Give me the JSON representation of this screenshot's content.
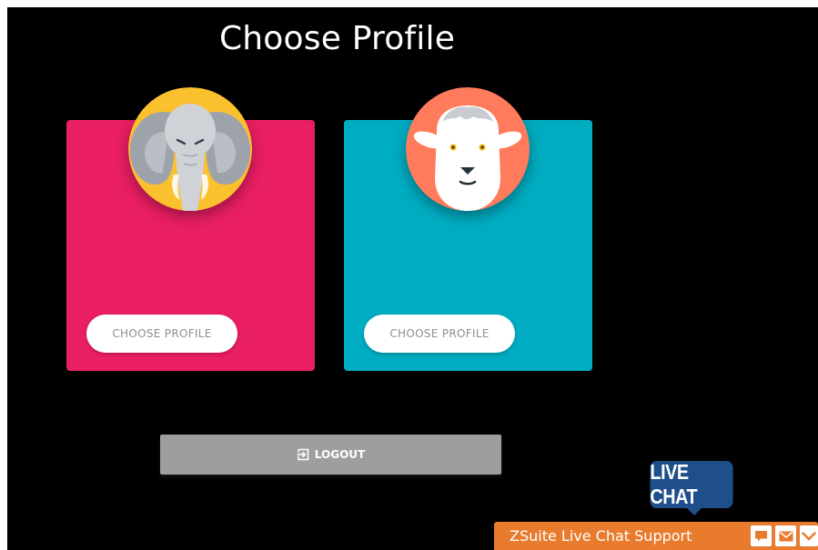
{
  "page": {
    "title": "Choose Profile"
  },
  "profiles": [
    {
      "avatar_icon": "elephant-icon",
      "color": "#e91e63",
      "button_label": "CHOOSE PROFILE"
    },
    {
      "avatar_icon": "sheep-icon",
      "color": "#00acc1",
      "button_label": "CHOOSE PROFILE"
    }
  ],
  "logout": {
    "label": "LOGOUT",
    "icon": "logout-icon"
  },
  "live_chat": {
    "badge_text": "LIVE CHAT",
    "bar_title": "ZSuite Live Chat Support",
    "controls": [
      "chat-bubble-icon",
      "mail-icon",
      "chevron-down-icon"
    ],
    "accent": "#e87b2d",
    "badge_color": "#1e4f8a"
  }
}
